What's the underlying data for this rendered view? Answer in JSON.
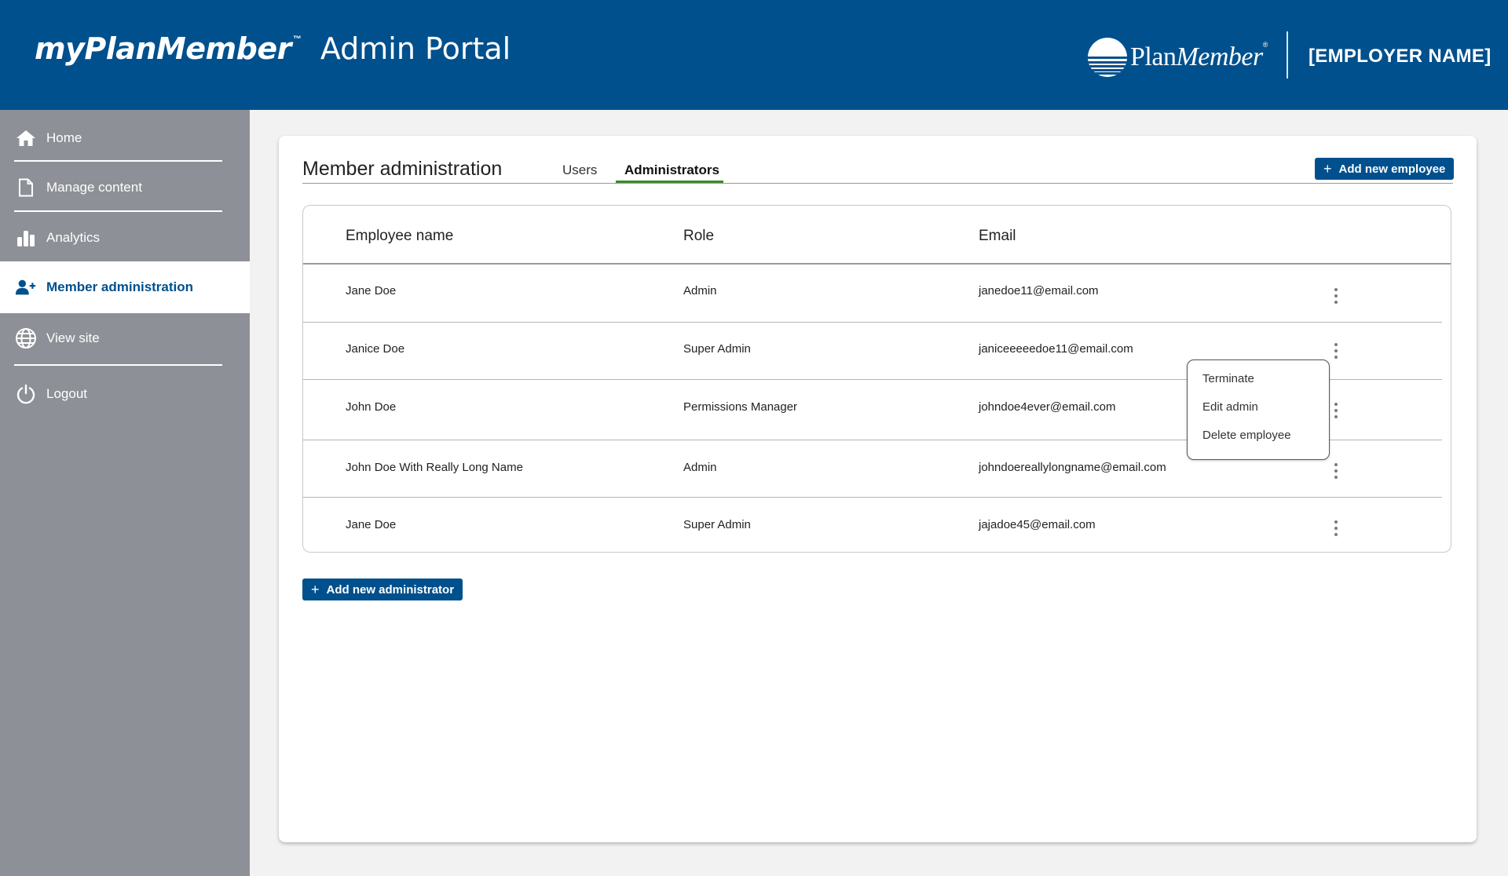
{
  "header": {
    "brand_name": "myPlanMember",
    "brand_tm": "™",
    "portal_title": "Admin Portal",
    "logo_plan": "Plan",
    "logo_member": "Member",
    "logo_reg": "®",
    "employer_name": "[EMPLOYER NAME]",
    "background_color": "#00508d"
  },
  "sidebar": {
    "items": [
      {
        "label": "Home",
        "icon": "home-icon"
      },
      {
        "label": "Manage content",
        "icon": "document-icon"
      },
      {
        "label": "Analytics",
        "icon": "bar-chart-icon"
      },
      {
        "label": "Member administration",
        "icon": "add-user-icon",
        "active": true
      },
      {
        "label": "View site",
        "icon": "globe-icon"
      },
      {
        "label": "Logout",
        "icon": "power-icon"
      }
    ]
  },
  "main": {
    "title": "Member administration",
    "tabs": [
      {
        "label": "Users",
        "active": false
      },
      {
        "label": "Administrators",
        "active": true
      }
    ],
    "add_employee_label": "Add new employee",
    "add_admin_label": "Add new administrator",
    "table": {
      "columns": [
        "Employee name",
        "Role",
        "Email"
      ],
      "rows": [
        {
          "name": "Jane Doe",
          "role": "Admin",
          "email": "janedoe11@email.com"
        },
        {
          "name": "Janice Doe",
          "role": "Super Admin",
          "email": "janiceeeeedoe11@email.com"
        },
        {
          "name": "John Doe",
          "role": "Permissions Manager",
          "email": "johndoe4ever@email.com"
        },
        {
          "name": "John Doe With Really Long Name",
          "role": "Admin",
          "email": "johndoereallylongname@email.com"
        },
        {
          "name": "Jane Doe",
          "role": "Super Admin",
          "email": "jajadoe45@email.com"
        }
      ]
    },
    "row_menu": {
      "items": [
        "Terminate",
        "Edit admin",
        "Delete employee"
      ]
    },
    "colors": {
      "primary": "#00508d",
      "tab_underline": "#3a8a2a",
      "sidebar": "#8e9097"
    }
  }
}
